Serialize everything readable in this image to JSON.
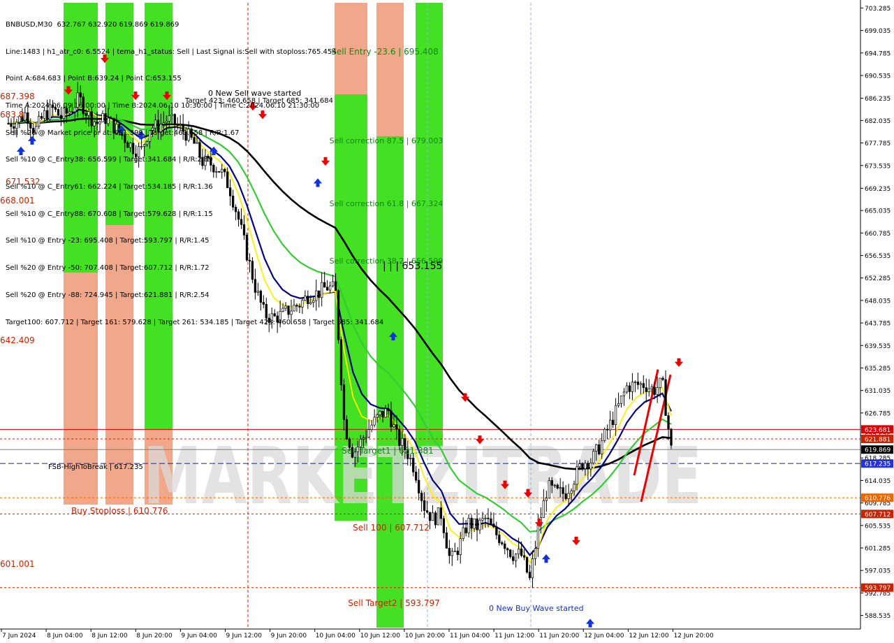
{
  "header": {
    "symbol_line": "BNBUSD,M30  632.767 632.920 619.869 619.869",
    "lines": [
      "Line:1483 | h1_atr_c0: 6.5524 | tema_h1_status: Sell | Last Signal is:Sell with stoploss:765.454",
      "Point A:684.683 | Point B:639.24 | Point C:653.155",
      "Time A:2024.06.09 16:00:00 | Time B:2024.06.10 10:30:00 | Time C:2024.06.10 21:30:00",
      "Sell %20 @ Market price or at: 651.399 | Target:460.658 | R/R:1.67",
      "Sell %10 @ C_Entry38: 656.599 | Target:341.684 | R/R:2.89",
      "Sell %10 @ C_Entry61: 662.224 | Target:534.185 | R/R:1.36",
      "Sell %10 @ C_Entry88: 670.608 | Target:579.628 | R/R:1.15",
      "Sell %10 @ Entry -23: 695.408 | Target:593.797 | R/R:1.45",
      "Sell %20 @ Entry -50: 707.408 | Target:607.712 | R/R:1.72",
      "Sell %20 @ Entry -88: 724.945 | Target:621.881 | R/R:2.54",
      "Target100: 607.712 | Target 161: 579.628 | Target 261: 534.185 | Target 423: 460.658 | Target 685: 341.684"
    ]
  },
  "watermark": "MARKETZITRADE",
  "colors": {
    "green_zone": "#33dd11",
    "orange_zone": "#f0a080",
    "price_line_red": "#dd0000",
    "dashed_red": "#cc2200",
    "dashed_blue": "#2233dd",
    "ma_black": "#000000",
    "ma_navy": "#000080",
    "ma_yellow": "#ffee00",
    "ma_green": "#33cc33",
    "candle": "#000000"
  },
  "chart_data": {
    "type": "candlestick",
    "symbol": "BNBUSD",
    "timeframe": "M30",
    "ylim": [
      586.5,
      704.0
    ],
    "y_ticks": [
      "703.285",
      "699.035",
      "694.785",
      "690.535",
      "686.235",
      "682.035",
      "677.785",
      "673.535",
      "669.235",
      "665.035",
      "660.785",
      "656.535",
      "652.285",
      "648.035",
      "643.785",
      "639.535",
      "635.285",
      "631.035",
      "626.785",
      "622.535",
      "618.285",
      "614.035",
      "609.785",
      "605.535",
      "601.285",
      "597.035",
      "592.785",
      "588.535"
    ],
    "x_ticks": [
      "7 Jun 2024",
      "8 Jun 04:00",
      "8 Jun 12:00",
      "8 Jun 20:00",
      "9 Jun 04:00",
      "9 Jun 12:00",
      "9 Jun 20:00",
      "10 Jun 04:00",
      "10 Jun 12:00",
      "10 Jun 20:00",
      "11 Jun 04:00",
      "11 Jun 12:00",
      "11 Jun 20:00",
      "12 Jun 04:00",
      "12 Jun 12:00",
      "12 Jun 20:00"
    ],
    "price_badges": [
      {
        "label": "623.681",
        "value": 623.681,
        "color": "#dd0000"
      },
      {
        "label": "621.881",
        "value": 621.881,
        "color": "#cc2200"
      },
      {
        "label": "619.869",
        "value": 619.869,
        "color": "#000000"
      },
      {
        "label": "617.235",
        "value": 617.235,
        "color": "#2233dd"
      },
      {
        "label": "610.776",
        "value": 610.776,
        "color": "#ee6600"
      },
      {
        "label": "607.712",
        "value": 607.712,
        "color": "#cc2200"
      },
      {
        "label": "593.797",
        "value": 593.797,
        "color": "#cc2200"
      }
    ],
    "levels": [
      {
        "name": "sell-entry",
        "text": "Sell Entry -23.6 | 695.408",
        "value": 695.408,
        "color": "#118811"
      },
      {
        "name": "sell-correction-875",
        "text": "Sell correction 87.5 | 679.003",
        "value": 679.003,
        "color": "#118811"
      },
      {
        "name": "sell-correction-618",
        "text": "Sell correction 61.8 | 667.324",
        "value": 667.324,
        "color": "#118811"
      },
      {
        "name": "sell-correction-382",
        "text": "Sell correction 38.2 | 656.599",
        "value": 656.599,
        "color": "#118811"
      },
      {
        "name": "sell-target1",
        "text": "Sell Target1 | 621.881",
        "value": 621.881,
        "color": "#118811"
      },
      {
        "name": "fsb-high-to-break",
        "text": "FSB-HighToBreak | 617.235",
        "value": 617.235,
        "color": "#000000"
      },
      {
        "name": "buy-stoploss",
        "text": "Buy Stoploss | 610.776",
        "value": 610.776,
        "color": "#cc2200"
      },
      {
        "name": "sell-100",
        "text": "Sell 100 | 607.712",
        "value": 607.712,
        "color": "#cc2200"
      },
      {
        "name": "sell-target2",
        "text": "Sell Target2 | 593.797",
        "value": 593.797,
        "color": "#cc2200"
      }
    ],
    "left_edge_labels": [
      {
        "text": "671.532",
        "value": 671.532
      },
      {
        "text": "668.001",
        "value": 668.001
      },
      {
        "text": "642.409",
        "value": 642.409
      },
      {
        "text": "601.001",
        "value": 601.001
      },
      {
        "text": "687.398",
        "value": 687.398
      },
      {
        "text": "683.8",
        "value": 683.8
      }
    ],
    "annotations": [
      {
        "text": "0 New Sell wave started",
        "value": 688.0
      },
      {
        "text": "Target 423: 460.658 | Target 685: 341.684",
        "value": 686.7
      },
      {
        "text": "| | | 653.155",
        "value": 653.5
      },
      {
        "text": "0 New Buy Wave started",
        "value": 591.6
      }
    ],
    "close_series": [
      681.5,
      682.0,
      683.5,
      680.0,
      683.0,
      684.2,
      682.6,
      684.0,
      686.2,
      683.2,
      681.5,
      682.5,
      680.8,
      679.0,
      677.0,
      676.2,
      680.7,
      681.0,
      682.3,
      681.2,
      679.8,
      677.7,
      674.2,
      673.8,
      672.6,
      669.5,
      663.7,
      656.8,
      650.1,
      645.3,
      644.7,
      645.4,
      646.5,
      647.4,
      649.1,
      649.4,
      650.6,
      650.1,
      624.7,
      619.1,
      621.7,
      624.3,
      626.3,
      627.2,
      622.0,
      619.8,
      616.2,
      609.3,
      606.8,
      607.7,
      598.7,
      601.6,
      606.1,
      605.2,
      606.8,
      604.2,
      602.6,
      600.1,
      600.1,
      595.2,
      605.5,
      612.8,
      611.7,
      611.6,
      614.4,
      617.5,
      617.8,
      620.8,
      624.3,
      627.9,
      631.8,
      632.1,
      632.2,
      631.1,
      632.4,
      619.9
    ]
  }
}
